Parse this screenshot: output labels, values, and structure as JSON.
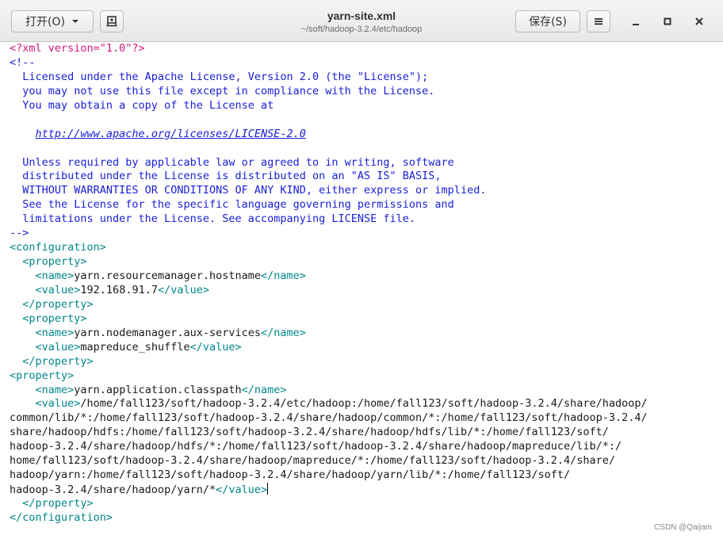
{
  "header": {
    "open_label": "打开(O)",
    "title": "yarn-site.xml",
    "path": "~/soft/hadoop-3.2.4/etc/hadoop",
    "save_label": "保存(S)",
    "icons": [
      "chevron-down-icon",
      "new-tab-icon",
      "hamburger-menu-icon",
      "minimize-icon",
      "maximize-icon",
      "close-icon"
    ]
  },
  "editor": {
    "decl": "<?xml version=\"1.0\"?>",
    "comment_open": "<!--",
    "license": [
      "  Licensed under the Apache License, Version 2.0 (the \"License\");",
      "  you may not use this file except in compliance with the License.",
      "  You may obtain a copy of the License at",
      "",
      "  Unless required by applicable law or agreed to in writing, software",
      "  distributed under the License is distributed on an \"AS IS\" BASIS,",
      "  WITHOUT WARRANTIES OR CONDITIONS OF ANY KIND, either express or implied.",
      "  See the License for the specific language governing permissions and",
      "  limitations under the License. See accompanying LICENSE file."
    ],
    "license_link": "http://www.apache.org/licenses/LICENSE-2.0",
    "comment_close": "-->",
    "tags": {
      "config_open": "<configuration>",
      "config_close": "</configuration>",
      "prop_open": "<property>",
      "prop_close": "</property>",
      "name_open": "<name>",
      "name_close": "</name>",
      "value_open": "<value>",
      "value_close": "</value>"
    },
    "props": [
      {
        "name": "yarn.resourcemanager.hostname",
        "value": "192.168.91.7"
      },
      {
        "name": "yarn.nodemanager.aux-services",
        "value": "mapreduce_shuffle"
      },
      {
        "name": "yarn.application.classpath",
        "value_lines": [
          "/home/fall123/soft/hadoop-3.2.4/etc/hadoop:/home/fall123/soft/hadoop-3.2.4/share/hadoop/",
          "common/lib/*:/home/fall123/soft/hadoop-3.2.4/share/hadoop/common/*:/home/fall123/soft/hadoop-3.2.4/",
          "share/hadoop/hdfs:/home/fall123/soft/hadoop-3.2.4/share/hadoop/hdfs/lib/*:/home/fall123/soft/",
          "hadoop-3.2.4/share/hadoop/hdfs/*:/home/fall123/soft/hadoop-3.2.4/share/hadoop/mapreduce/lib/*:/",
          "home/fall123/soft/hadoop-3.2.4/share/hadoop/mapreduce/*:/home/fall123/soft/hadoop-3.2.4/share/",
          "hadoop/yarn:/home/fall123/soft/hadoop-3.2.4/share/hadoop/yarn/lib/*:/home/fall123/soft/",
          "hadoop-3.2.4/share/hadoop/yarn/*"
        ]
      }
    ]
  },
  "watermark": "CSDN @Qaijam"
}
